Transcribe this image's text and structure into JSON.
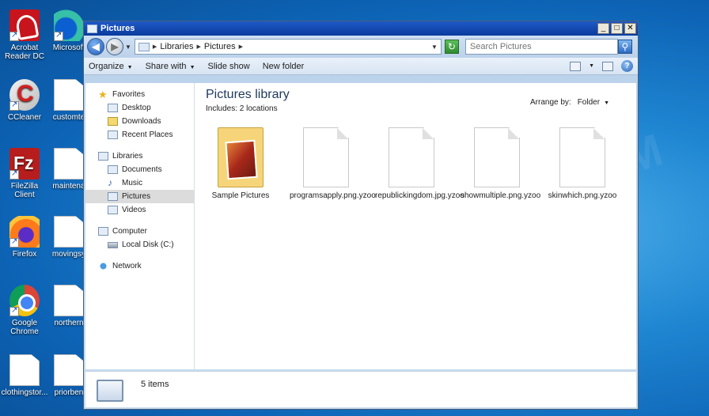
{
  "desktop": {
    "icons": [
      {
        "label": "Acrobat Reader DC"
      },
      {
        "label": "Microsoft"
      },
      {
        "label": "CCleaner"
      },
      {
        "label": "customte"
      },
      {
        "label": "FileZilla Client"
      },
      {
        "label": "maintena"
      },
      {
        "label": "Firefox"
      },
      {
        "label": "movingsy"
      },
      {
        "label": "Google Chrome"
      },
      {
        "label": "northern"
      },
      {
        "label": "clothingstor..."
      },
      {
        "label": "priorben"
      }
    ],
    "watermark": "MYANTISPYWARE.COM"
  },
  "window": {
    "title": "Pictures",
    "controls": {
      "minimize": "_",
      "maximize": "□",
      "close": "✕"
    }
  },
  "address": {
    "crumbs": [
      "Libraries",
      "Pictures"
    ],
    "search_placeholder": "Search Pictures"
  },
  "toolbar": {
    "organize": "Organize",
    "share_with": "Share with",
    "slide_show": "Slide show",
    "new_folder": "New folder"
  },
  "navigation": {
    "favorites": {
      "label": "Favorites",
      "items": [
        "Desktop",
        "Downloads",
        "Recent Places"
      ]
    },
    "libraries": {
      "label": "Libraries",
      "items": [
        "Documents",
        "Music",
        "Pictures",
        "Videos"
      ]
    },
    "computer": {
      "label": "Computer",
      "items": [
        "Local Disk (C:)"
      ]
    },
    "network": {
      "label": "Network"
    }
  },
  "library": {
    "title": "Pictures library",
    "includes": "Includes:  2 locations",
    "arrange_label": "Arrange by:",
    "arrange_value": "Folder"
  },
  "files": [
    {
      "name": "Sample Pictures",
      "type": "folder"
    },
    {
      "name": "programsapply.png.yzoo",
      "type": "file"
    },
    {
      "name": "republickingdom.jpg.yzoo",
      "type": "file"
    },
    {
      "name": "showmultiple.png.yzoo",
      "type": "file"
    },
    {
      "name": "skinwhich.png.yzoo",
      "type": "file"
    }
  ],
  "status": {
    "text": "5 items"
  }
}
